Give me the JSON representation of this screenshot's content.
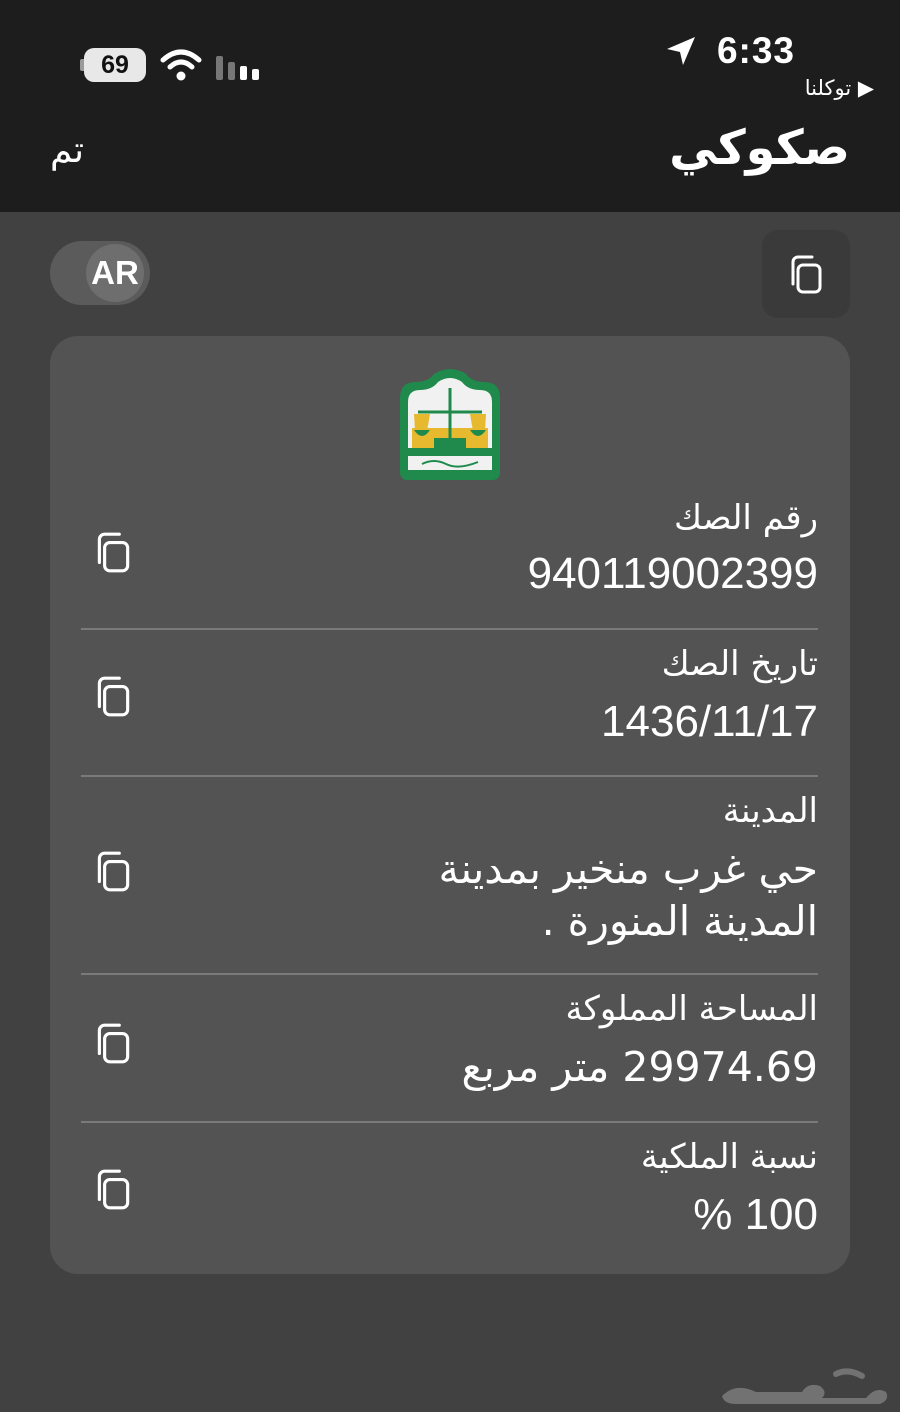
{
  "status_bar": {
    "time": "6:33",
    "back_app": "▶ توكلنا",
    "battery": "69"
  },
  "header": {
    "title": "صكوكي",
    "done_label": "تم"
  },
  "toolbar": {
    "language": "AR"
  },
  "card": {
    "logo_text": "وزارة العدل",
    "fields": [
      {
        "label": "رقم الصك",
        "value": "940119002399"
      },
      {
        "label": "تاريخ الصك",
        "value": "1436/11/17"
      },
      {
        "label": "المدينة",
        "value_line1": "حي  غرب منخير  بمدينة",
        "value_line2": "المدينة المنورة ."
      },
      {
        "label": "المساحة المملوكة",
        "value": "29974.69 متر مربع"
      },
      {
        "label": "نسبة الملكية",
        "value": "100 %"
      }
    ]
  },
  "watermark": "حراج",
  "colors": {
    "background": "#414141",
    "header": "#1d1d1d",
    "card": "#535353",
    "logo_green": "#1f8a4c",
    "logo_gold": "#e7b92e"
  }
}
